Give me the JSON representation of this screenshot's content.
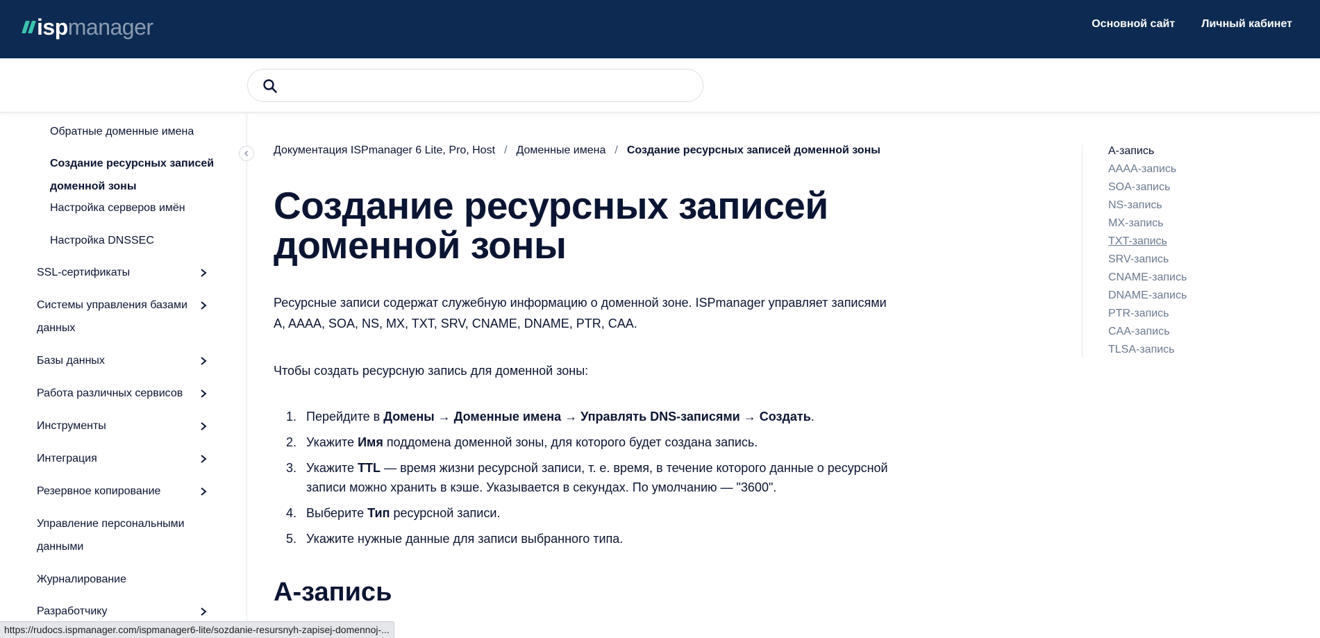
{
  "header": {
    "logo_isp": "isp",
    "logo_manager": "manager",
    "links": [
      {
        "label": "Основной сайт"
      },
      {
        "label": "Личный кабинет"
      }
    ]
  },
  "search": {
    "placeholder": "",
    "value": ""
  },
  "sidebar": {
    "items": [
      {
        "label": "Обратные доменные имена",
        "level": "sub",
        "has_chevron": false,
        "active": false
      },
      {
        "label": "Создание ресурсных записей доменной зоны",
        "level": "sub",
        "has_chevron": false,
        "active": true
      },
      {
        "label": "Настройка серверов имён",
        "level": "sub",
        "has_chevron": false,
        "active": false
      },
      {
        "label": "Настройка DNSSEC",
        "level": "sub",
        "has_chevron": false,
        "active": false
      },
      {
        "label": "SSL-сертификаты",
        "level": "top",
        "has_chevron": true,
        "active": false
      },
      {
        "label": "Системы управления базами данных",
        "level": "top",
        "has_chevron": true,
        "active": false
      },
      {
        "label": "Базы данных",
        "level": "top",
        "has_chevron": true,
        "active": false
      },
      {
        "label": "Работа различных сервисов",
        "level": "top",
        "has_chevron": true,
        "active": false
      },
      {
        "label": "Инструменты",
        "level": "top",
        "has_chevron": true,
        "active": false
      },
      {
        "label": "Интеграция",
        "level": "top",
        "has_chevron": true,
        "active": false
      },
      {
        "label": "Резервное копирование",
        "level": "top",
        "has_chevron": true,
        "active": false
      },
      {
        "label": "Управление персональными данными",
        "level": "top",
        "has_chevron": false,
        "active": false
      },
      {
        "label": "Журналирование",
        "level": "top",
        "has_chevron": false,
        "active": false
      },
      {
        "label": "Разработчику",
        "level": "top",
        "has_chevron": true,
        "active": false
      }
    ]
  },
  "breadcrumb": {
    "items": [
      {
        "label": "Документация ISPmanager 6 Lite, Pro, Host"
      },
      {
        "label": "Доменные имена"
      }
    ],
    "current": "Создание ресурсных записей доменной зоны",
    "separator": "/"
  },
  "main": {
    "title": "Создание ресурсных записей доменной зоны",
    "intro": "Ресурсные записи содержат служебную информацию о доменной зоне. ISPmanager управляет записями A, AAAA, SOA, NS, MX, TXT, SRV, CNAME, DNAME, PTR, CAA.",
    "lead": "Чтобы создать ресурсную запись для доменной зоны:",
    "steps": [
      {
        "num": "1.",
        "parts": [
          {
            "text": "Перейдите в ",
            "bold": false
          },
          {
            "text": "Домены",
            "bold": true
          },
          {
            "text": " → ",
            "bold": false
          },
          {
            "text": "Доменные имена",
            "bold": true
          },
          {
            "text": " → ",
            "bold": false
          },
          {
            "text": "Управлять DNS-записями",
            "bold": true
          },
          {
            "text": " → ",
            "bold": false
          },
          {
            "text": "Создать",
            "bold": true
          },
          {
            "text": ".",
            "bold": false
          }
        ]
      },
      {
        "num": "2.",
        "parts": [
          {
            "text": "Укажите ",
            "bold": false
          },
          {
            "text": "Имя",
            "bold": true
          },
          {
            "text": " поддомена доменной зоны, для которого будет создана запись.",
            "bold": false
          }
        ]
      },
      {
        "num": "3.",
        "parts": [
          {
            "text": "Укажите ",
            "bold": false
          },
          {
            "text": "TTL",
            "bold": true
          },
          {
            "text": " — время жизни ресурсной записи, т. е. время, в течение которого данные о ресурсной записи можно хранить в кэше. Указывается в секундах. По умолчанию — \"3600\".",
            "bold": false
          }
        ]
      },
      {
        "num": "4.",
        "parts": [
          {
            "text": "Выберите ",
            "bold": false
          },
          {
            "text": "Тип",
            "bold": true
          },
          {
            "text": " ресурсной записи.",
            "bold": false
          }
        ]
      },
      {
        "num": "5.",
        "parts": [
          {
            "text": "Укажите нужные данные для записи выбранного типа.",
            "bold": false
          }
        ]
      }
    ],
    "section_heading": "A-запись"
  },
  "toc": {
    "items": [
      {
        "label": "A-запись",
        "state": "current"
      },
      {
        "label": "AAAA-запись",
        "state": "normal"
      },
      {
        "label": "SOA-запись",
        "state": "normal"
      },
      {
        "label": "NS-запись",
        "state": "normal"
      },
      {
        "label": "MX-запись",
        "state": "normal"
      },
      {
        "label": "TXT-запись",
        "state": "hover"
      },
      {
        "label": "SRV-запись",
        "state": "normal"
      },
      {
        "label": "CNAME-запись",
        "state": "normal"
      },
      {
        "label": "DNAME-запись",
        "state": "normal"
      },
      {
        "label": "PTR-запись",
        "state": "normal"
      },
      {
        "label": "CAA-запись",
        "state": "normal"
      },
      {
        "label": "TLSA-запись",
        "state": "normal"
      }
    ]
  },
  "status_bar": {
    "url": "https://rudocs.ispmanager.com/ispmanager6-lite/sozdanie-resursnyh-zapisej-domennoj-..."
  },
  "colors": {
    "header_bg": "#0d2b52",
    "logo_accent": "#3cc3ad",
    "text_dark": "#0b1533",
    "toc_text": "#6a7a90"
  }
}
